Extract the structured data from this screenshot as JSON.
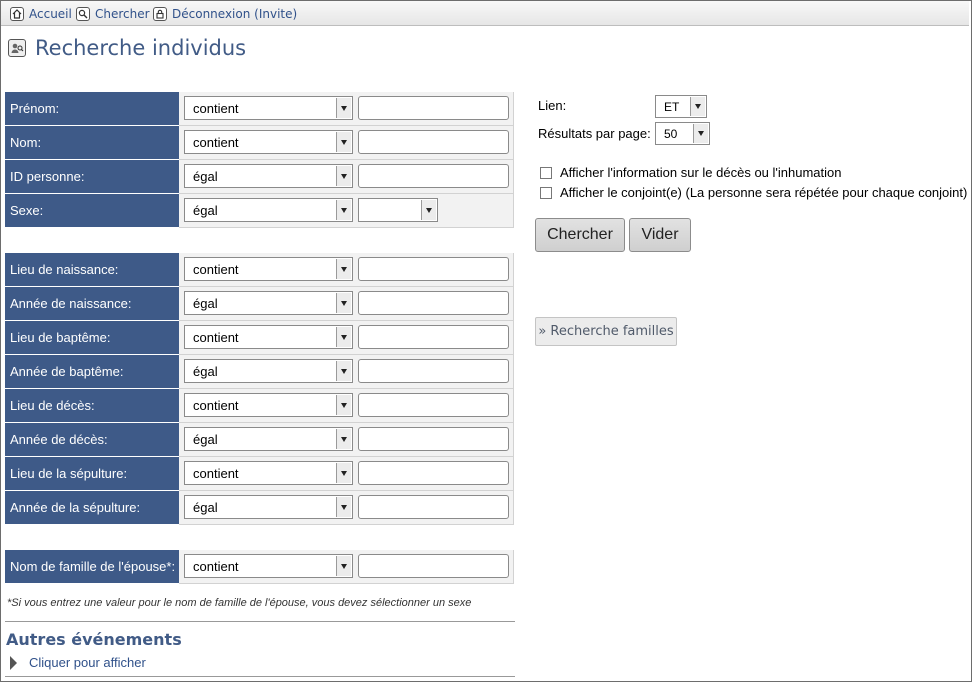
{
  "nav": {
    "home_label": "Accueil",
    "search_label": "Chercher",
    "logout_label": "Déconnexion (Invite)"
  },
  "page_title": "Recherche individus",
  "fields": {
    "prenom": {
      "label": "Prénom:",
      "operator": "contient"
    },
    "nom": {
      "label": "Nom:",
      "operator": "contient"
    },
    "id": {
      "label": "ID personne:",
      "operator": "égal"
    },
    "sexe": {
      "label": "Sexe:",
      "operator": "égal"
    },
    "lieu_naissance": {
      "label": "Lieu de naissance:",
      "operator": "contient"
    },
    "annee_naissance": {
      "label": "Année de naissance:",
      "operator": "égal"
    },
    "lieu_bapteme": {
      "label": "Lieu de baptême:",
      "operator": "contient"
    },
    "annee_bapteme": {
      "label": "Année de baptême:",
      "operator": "égal"
    },
    "lieu_deces": {
      "label": "Lieu de décès:",
      "operator": "contient"
    },
    "annee_deces": {
      "label": "Année de décès:",
      "operator": "égal"
    },
    "lieu_sepulture": {
      "label": "Lieu de la sépulture:",
      "operator": "contient"
    },
    "annee_sepulture": {
      "label": "Année de la sépulture:",
      "operator": "égal"
    },
    "nom_epouse": {
      "label": "Nom de famille de l'épouse*:",
      "operator": "contient"
    }
  },
  "note": "*Si vous entrez une valeur pour le nom de famille de l'épouse, vous devez sélectionner un sexe",
  "other_events": {
    "title": "Autres événements",
    "toggle_label": "Cliquer pour afficher"
  },
  "options": {
    "lien_label": "Lien:",
    "lien_value": "ET",
    "results_label": "Résultats par page:",
    "results_value": "50",
    "show_death_label": "Afficher l'information sur le décès ou l'inhumation",
    "show_spouse_label": "Afficher le conjoint(e) (La personne sera répétée pour chaque conjoint)"
  },
  "buttons": {
    "search": "Chercher",
    "clear": "Vider",
    "family_search": "» Recherche familles"
  }
}
